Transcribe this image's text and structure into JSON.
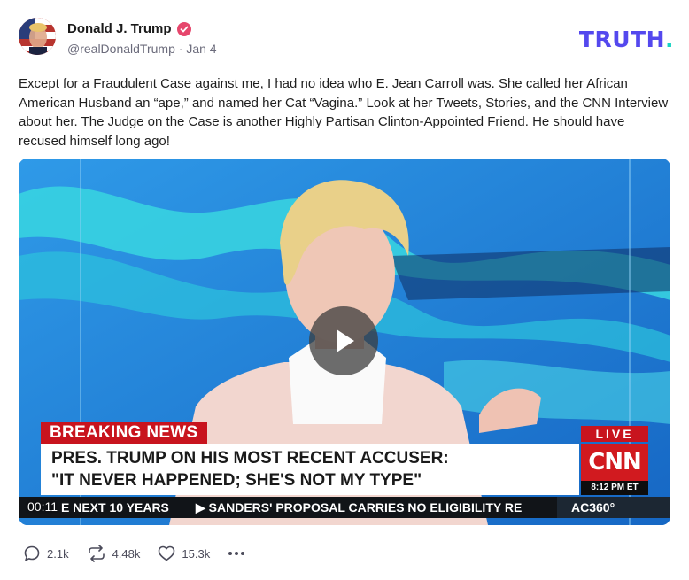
{
  "post": {
    "author_name": "Donald J. Trump",
    "handle": "@realDonaldTrump",
    "separator": "·",
    "date": "Jan 4",
    "brand": "TRUTH",
    "brand_dot": ".",
    "text": "Except for a Fraudulent Case against me, I had no idea who E. Jean Carroll was. She called her African American Husband an “ape,” and named her Cat “Vagina.” Look at her Tweets, Stories, and the CNN Interview about her. The Judge on the Case is another Highly Partisan Clinton-Appointed Friend. He should have recused himself long ago!"
  },
  "video": {
    "breaking_label": "BREAKING NEWS",
    "headline_line1": "PRES. TRUMP ON HIS MOST RECENT ACCUSER:",
    "headline_line2": "\"IT NEVER HAPPENED; SHE'S NOT MY TYPE\"",
    "live_label": "LIVE",
    "network_logo": "CNN",
    "network_time": "8:12 PM ET",
    "ticker_left": "E NEXT 10 YEARS",
    "ticker_right": "▶  SANDERS' PROPOSAL CARRIES NO ELIGIBILITY RE",
    "show_label": "AC360°",
    "timecode": "00:11"
  },
  "actions": {
    "replies": "2.1k",
    "retruths": "4.48k",
    "likes": "15.3k"
  },
  "colors": {
    "brand": "#5448ee",
    "brand_dot": "#17d4c4",
    "verified": "#e6466c",
    "breaking_red": "#c8141e"
  },
  "icons": [
    "verified-badge-icon",
    "play-icon",
    "reply-icon",
    "retruth-icon",
    "like-icon",
    "more-icon"
  ]
}
